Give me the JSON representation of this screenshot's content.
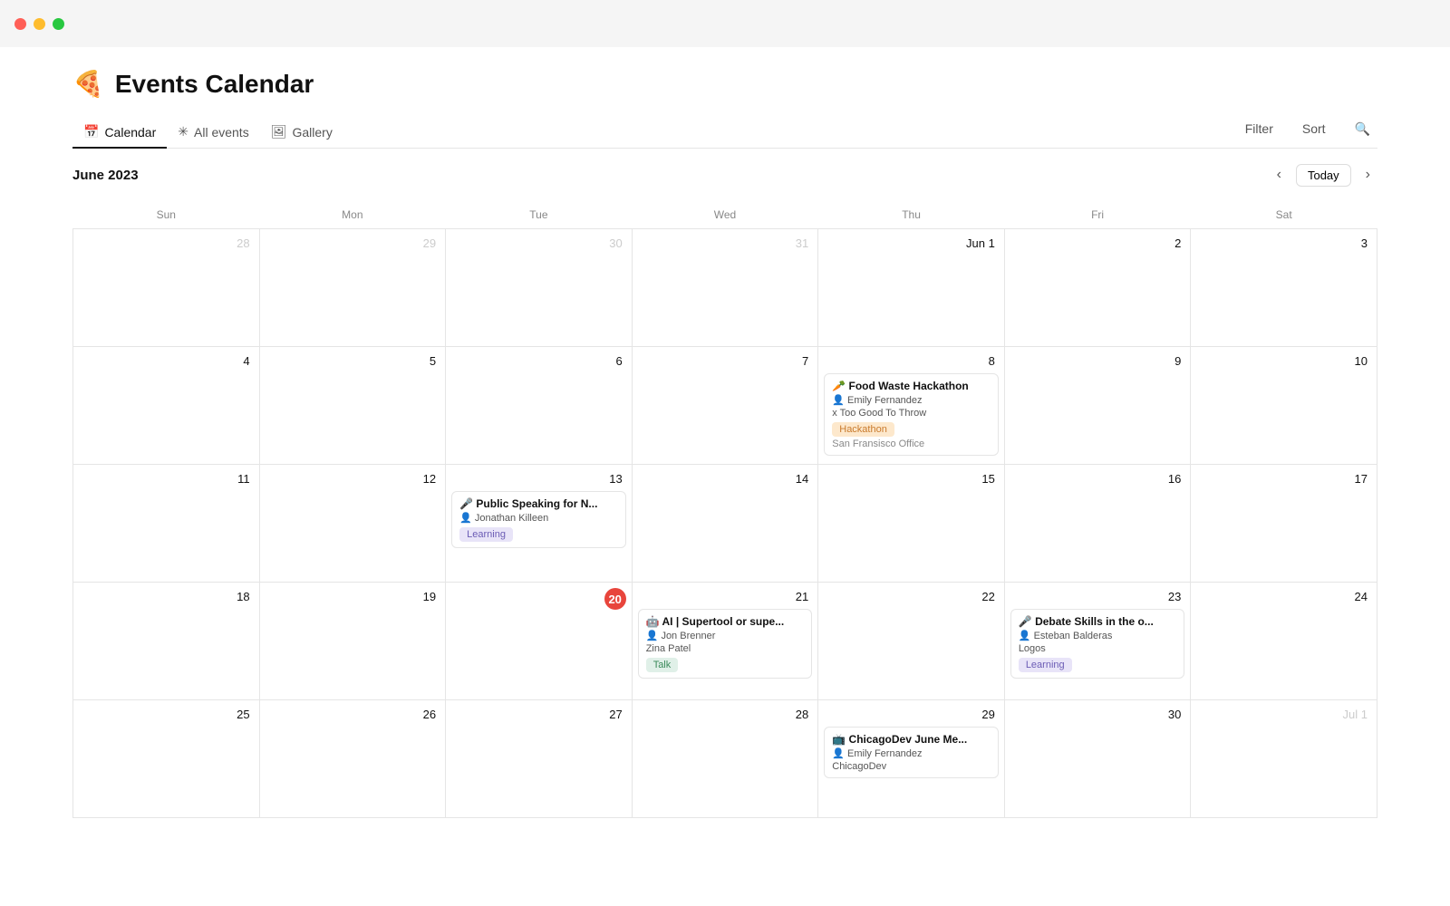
{
  "titlebar": {
    "close": "close",
    "minimize": "minimize",
    "maximize": "maximize"
  },
  "app": {
    "icon": "🍕",
    "title": "Events Calendar"
  },
  "tabs": [
    {
      "id": "calendar",
      "label": "Calendar",
      "icon": "📅",
      "active": true
    },
    {
      "id": "all-events",
      "label": "All events",
      "icon": "✳",
      "active": false
    },
    {
      "id": "gallery",
      "label": "Gallery",
      "icon": "🖼",
      "active": false
    }
  ],
  "toolbar": {
    "filter_label": "Filter",
    "sort_label": "Sort",
    "search_icon": "🔍"
  },
  "calendar": {
    "month_label": "June 2023",
    "today_label": "Today",
    "days_of_week": [
      "Sun",
      "Mon",
      "Tue",
      "Wed",
      "Thu",
      "Fri",
      "Sat"
    ],
    "weeks": [
      [
        {
          "num": "28",
          "type": "other"
        },
        {
          "num": "29",
          "type": "other"
        },
        {
          "num": "30",
          "type": "other"
        },
        {
          "num": "31",
          "type": "other"
        },
        {
          "num": "Jun 1",
          "type": "current"
        },
        {
          "num": "2",
          "type": "current"
        },
        {
          "num": "3",
          "type": "current"
        }
      ],
      [
        {
          "num": "4",
          "type": "current"
        },
        {
          "num": "5",
          "type": "current"
        },
        {
          "num": "6",
          "type": "current"
        },
        {
          "num": "7",
          "type": "current"
        },
        {
          "num": "8",
          "type": "current",
          "event": {
            "icon": "🥕",
            "title": "Food Waste Hackathon",
            "person": "Emily Fernandez",
            "person_icon": "👤",
            "org": "x Too Good To Throw",
            "tag": "Hackathon",
            "tag_class": "tag-hackathon",
            "location": "San Fransisco Office"
          }
        },
        {
          "num": "9",
          "type": "current"
        },
        {
          "num": "10",
          "type": "current"
        }
      ],
      [
        {
          "num": "11",
          "type": "current"
        },
        {
          "num": "12",
          "type": "current"
        },
        {
          "num": "13",
          "type": "current",
          "event": {
            "icon": "🎤",
            "title": "Public Speaking for N...",
            "person": "Jonathan Killeen",
            "person_icon": "👤",
            "tag": "Learning",
            "tag_class": "tag-learning"
          }
        },
        {
          "num": "14",
          "type": "current"
        },
        {
          "num": "15",
          "type": "current"
        },
        {
          "num": "16",
          "type": "current"
        },
        {
          "num": "17",
          "type": "current"
        }
      ],
      [
        {
          "num": "18",
          "type": "current"
        },
        {
          "num": "19",
          "type": "current"
        },
        {
          "num": "20",
          "type": "today"
        },
        {
          "num": "21",
          "type": "current",
          "event": {
            "icon": "🤖",
            "title": "AI | Supertool or supe...",
            "person": "Jon Brenner",
            "person_icon": "👤",
            "org": "Zina Patel",
            "tag": "Talk",
            "tag_class": "tag-talk"
          }
        },
        {
          "num": "22",
          "type": "current"
        },
        {
          "num": "23",
          "type": "current",
          "event": {
            "icon": "🎤",
            "title": "Debate Skills in the o...",
            "person": "Esteban Balderas",
            "person_icon": "👤",
            "org": "Logos",
            "tag": "Learning",
            "tag_class": "tag-learning"
          }
        },
        {
          "num": "24",
          "type": "current"
        }
      ],
      [
        {
          "num": "25",
          "type": "current"
        },
        {
          "num": "26",
          "type": "current"
        },
        {
          "num": "27",
          "type": "current"
        },
        {
          "num": "28",
          "type": "current"
        },
        {
          "num": "29",
          "type": "current",
          "event": {
            "icon": "📺",
            "title": "ChicagoDev June Me...",
            "person": "Emily Fernandez",
            "person_icon": "👤",
            "org": "ChicagoDev"
          }
        },
        {
          "num": "30",
          "type": "current"
        },
        {
          "num": "Jul 1",
          "type": "other"
        }
      ]
    ]
  }
}
